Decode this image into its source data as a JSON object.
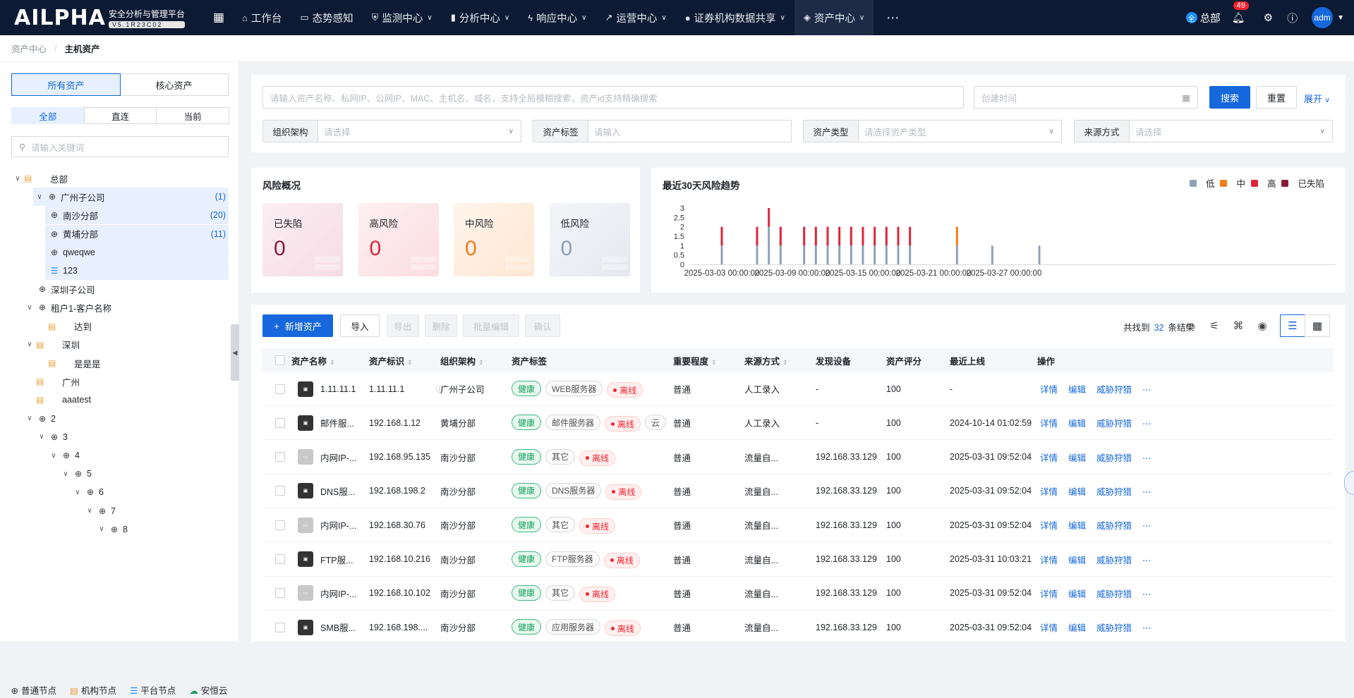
{
  "app": {
    "logo": "AILPHA",
    "subtitle": "安全分析与管理平台",
    "version": "V5.1R23C02"
  },
  "nav": [
    {
      "label": "工作台",
      "icon": "home-icon"
    },
    {
      "label": "态势感知",
      "icon": "monitor-icon"
    },
    {
      "label": "监测中心",
      "icon": "shield-icon",
      "caret": true
    },
    {
      "label": "分析中心",
      "icon": "bar-chart-icon",
      "caret": true
    },
    {
      "label": "响应中心",
      "icon": "bolt-icon",
      "caret": true
    },
    {
      "label": "运营中心",
      "icon": "trend-icon",
      "caret": true
    },
    {
      "label": "证券机构数据共享",
      "icon": "share-icon",
      "caret": true
    },
    {
      "label": "资产中心",
      "icon": "layers-icon",
      "caret": true,
      "active": true
    }
  ],
  "header": {
    "org": "总部",
    "org_badge": "全",
    "notifications": "49",
    "avatar": "adm"
  },
  "breadcrumb": [
    "资产中心",
    "主机资产"
  ],
  "left": {
    "tabs": [
      "所有资产",
      "核心资产"
    ],
    "subtabs": [
      "全部",
      "直连",
      "当前"
    ],
    "search_placeholder": "请输入关键词",
    "tree": [
      {
        "label": "总部",
        "type": "org",
        "level": 0,
        "expanded": true
      },
      {
        "label": "广州子公司",
        "type": "glb",
        "level": 1,
        "expanded": true,
        "count": "(1)",
        "selected": true
      },
      {
        "label": "南沙分部",
        "type": "glb",
        "level": 2,
        "count": "(20)",
        "selected": true
      },
      {
        "label": "黄埔分部",
        "type": "glb",
        "level": 2,
        "count": "(11)",
        "selected": true
      },
      {
        "label": "qweqwe",
        "type": "glb",
        "level": 2,
        "selected": true
      },
      {
        "label": "123",
        "type": "plat",
        "level": 2,
        "selected": true
      },
      {
        "label": "深圳子公司",
        "type": "glb",
        "level": 1
      },
      {
        "label": "租户1-客户名称",
        "type": "glb",
        "level": 1,
        "expanded": true
      },
      {
        "label": "达到",
        "type": "org",
        "level": 2
      },
      {
        "label": "深圳",
        "type": "org",
        "level": 1,
        "expanded": true
      },
      {
        "label": "是是是",
        "type": "org",
        "level": 2
      },
      {
        "label": "广州",
        "type": "org",
        "level": 1
      },
      {
        "label": "aaatest",
        "type": "org",
        "level": 1
      },
      {
        "label": "2",
        "type": "glb",
        "level": 1,
        "expanded": true
      },
      {
        "label": "3",
        "type": "glb",
        "level": 2,
        "expanded": true
      },
      {
        "label": "4",
        "type": "glb",
        "level": 3,
        "expanded": true
      },
      {
        "label": "5",
        "type": "glb",
        "level": 4,
        "expanded": true
      },
      {
        "label": "6",
        "type": "glb",
        "level": 5,
        "expanded": true
      },
      {
        "label": "7",
        "type": "glb",
        "level": 6,
        "expanded": true
      },
      {
        "label": "8",
        "type": "glb",
        "level": 7,
        "expanded": true
      }
    ],
    "legend": [
      "普通节点",
      "机构节点",
      "平台节点",
      "安恒云"
    ]
  },
  "filters": {
    "search_placeholder": "请输入资产名称、私网IP、公网IP、MAC、主机名、域名，支持全局模糊搜索，资产id支持精确搜索",
    "date_placeholder": "创建时间",
    "search_btn": "搜索",
    "reset_btn": "重置",
    "expand": "展开",
    "fields": [
      {
        "label": "组织架构",
        "placeholder": "请选择"
      },
      {
        "label": "资产标签",
        "placeholder": "请输入"
      },
      {
        "label": "资产类型",
        "placeholder": "请选择资产类型"
      },
      {
        "label": "来源方式",
        "placeholder": "请选择"
      }
    ]
  },
  "risk": {
    "title": "风险概况",
    "cards": [
      {
        "label": "已失陷",
        "value": "0",
        "color": "#8a1c3a"
      },
      {
        "label": "高风险",
        "value": "0",
        "color": "#e0243a"
      },
      {
        "label": "中风险",
        "value": "0",
        "color": "#f07a1c"
      },
      {
        "label": "低风险",
        "value": "0",
        "color": "#8da0b8"
      }
    ]
  },
  "trend_title": "最近30天风险趋势",
  "chart_data": {
    "type": "bar",
    "title": "最近30天风险趋势",
    "xlabel": "",
    "ylabel": "",
    "ylim": [
      0,
      3
    ],
    "yticks": [
      "0",
      "0.5",
      "1",
      "1.5",
      "2",
      "2.5",
      "3"
    ],
    "xticks": [
      "2025-03-03 00:00:00",
      "2025-03-09 00:00:00",
      "2025-03-15 00:00:00",
      "2025-03-21 00:00:00",
      "2025-03-27 00:00:00"
    ],
    "stacked": true,
    "legend_position": "top-right",
    "categories": [
      "2025-03-03",
      "2025-03-06",
      "2025-03-07",
      "2025-03-08",
      "2025-03-10",
      "2025-03-11",
      "2025-03-12",
      "2025-03-13",
      "2025-03-14",
      "2025-03-15",
      "2025-03-16",
      "2025-03-17",
      "2025-03-18",
      "2025-03-19",
      "2025-03-23",
      "2025-03-26",
      "2025-03-30"
    ],
    "series": [
      {
        "name": "低",
        "color": "#8fa1b6",
        "values": [
          1,
          1,
          2,
          1,
          1,
          1,
          1,
          1,
          1,
          1,
          1,
          1,
          1,
          1,
          1,
          1,
          1
        ]
      },
      {
        "name": "中",
        "color": "#f37d1d",
        "values": [
          0,
          0,
          0,
          0,
          0,
          0,
          0,
          0,
          0,
          0,
          0,
          0,
          0,
          0,
          1,
          0,
          0
        ]
      },
      {
        "name": "高",
        "color": "#e0243a",
        "values": [
          1,
          1,
          1,
          1,
          1,
          1,
          1,
          1,
          1,
          1,
          1,
          1,
          1,
          1,
          0,
          0,
          0
        ]
      },
      {
        "name": "已失陷",
        "color": "#8a1c3a",
        "values": [
          0,
          0,
          0,
          0,
          0,
          0,
          0,
          0,
          0,
          0,
          0,
          0,
          0,
          0,
          0,
          0,
          0
        ]
      }
    ]
  },
  "table": {
    "toolbar": [
      "新增资产",
      "导入",
      "导出",
      "删除",
      "批量编辑",
      "确认"
    ],
    "found_prefix": "共找到",
    "found_count": "32",
    "found_suffix": "条结果",
    "headers": [
      "资产名称",
      "资产标识",
      "组织架构",
      "资产标签",
      "重要程度",
      "来源方式",
      "发现设备",
      "资产评分",
      "最近上线",
      "操作"
    ],
    "ops": [
      "详情",
      "编辑",
      "威胁狩猎"
    ],
    "rows": [
      {
        "name": "1.11.11.1",
        "id": "1.11.11.1",
        "org": "广州子公司",
        "tags": [
          "健康",
          "WEB服务器",
          "离线"
        ],
        "imp": "普通",
        "src": "人工录入",
        "dev": "-",
        "score": "100",
        "last": "-",
        "icon": "WEB"
      },
      {
        "name": "邮件服...",
        "id": "192.168.1.12",
        "org": "黄埔分部",
        "tags": [
          "健康",
          "邮件服务器",
          "离线",
          "云"
        ],
        "imp": "普通",
        "src": "人工录入",
        "dev": "-",
        "score": "100",
        "last": "2024-10-14 01:02:59",
        "icon": "MAIL"
      },
      {
        "name": "内网IP-...",
        "id": "192.168.95.135",
        "org": "南沙分部",
        "tags": [
          "健康",
          "其它",
          "离线"
        ],
        "imp": "普通",
        "src": "流量自...",
        "dev": "192.168.33.129",
        "score": "100",
        "last": "2025-03-31 09:52:04",
        "icon": "IP",
        "light": true
      },
      {
        "name": "DNS服...",
        "id": "192.168.198.2",
        "org": "南沙分部",
        "tags": [
          "健康",
          "DNS服务器",
          "离线"
        ],
        "imp": "普通",
        "src": "流量自...",
        "dev": "192.168.33.129",
        "score": "100",
        "last": "2025-03-31 09:52:04",
        "icon": "DNS"
      },
      {
        "name": "内网IP-...",
        "id": "192.168.30.76",
        "org": "南沙分部",
        "tags": [
          "健康",
          "其它",
          "离线"
        ],
        "imp": "普通",
        "src": "流量自...",
        "dev": "192.168.33.129",
        "score": "100",
        "last": "2025-03-31 09:52:04",
        "icon": "IP",
        "light": true
      },
      {
        "name": "FTP服...",
        "id": "192.168.10.216",
        "org": "南沙分部",
        "tags": [
          "健康",
          "FTP服务器",
          "离线"
        ],
        "imp": "普通",
        "src": "流量自...",
        "dev": "192.168.33.129",
        "score": "100",
        "last": "2025-03-31 10:03:21",
        "icon": "FTP"
      },
      {
        "name": "内网IP-...",
        "id": "192.168.10.102",
        "org": "南沙分部",
        "tags": [
          "健康",
          "其它",
          "离线"
        ],
        "imp": "普通",
        "src": "流量自...",
        "dev": "192.168.33.129",
        "score": "100",
        "last": "2025-03-31 09:52:04",
        "icon": "IP",
        "light": true
      },
      {
        "name": "SMB服...",
        "id": "192.168.198....",
        "org": "南沙分部",
        "tags": [
          "健康",
          "应用服务器",
          "离线"
        ],
        "imp": "普通",
        "src": "流量自...",
        "dev": "192.168.33.129",
        "score": "100",
        "last": "2025-03-31 09:52:04",
        "icon": "APP"
      }
    ]
  }
}
